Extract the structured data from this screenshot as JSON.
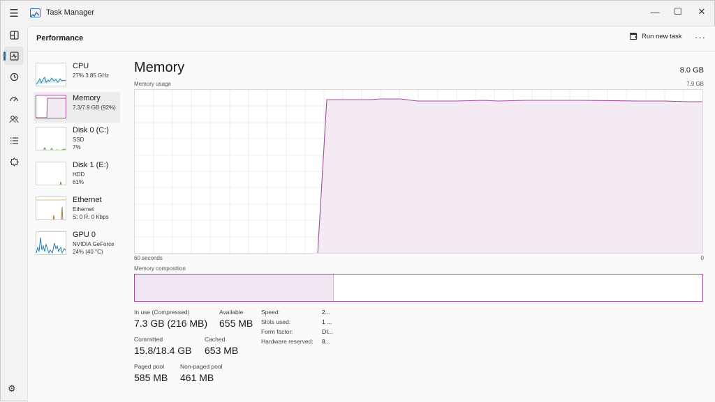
{
  "app": {
    "title": "Task Manager"
  },
  "window_controls": {
    "minimize": "—",
    "maximize": "☐",
    "close": "✕"
  },
  "header": {
    "title": "Performance",
    "run_new_task": "Run new task",
    "more": "···"
  },
  "rail": {
    "items": [
      {
        "name": "processes-icon"
      },
      {
        "name": "performance-icon",
        "active": true
      },
      {
        "name": "app-history-icon"
      },
      {
        "name": "startup-apps-icon"
      },
      {
        "name": "users-icon"
      },
      {
        "name": "details-icon"
      },
      {
        "name": "services-icon"
      }
    ]
  },
  "resources": [
    {
      "name": "CPU",
      "line1": "27%  3.85 GHz",
      "line2": ""
    },
    {
      "name": "Memory",
      "line1": "7.3/7.9 GB (92%)",
      "line2": ""
    },
    {
      "name": "Disk 0 (C:)",
      "line1": "SSD",
      "line2": "7%"
    },
    {
      "name": "Disk 1 (E:)",
      "line1": "HDD",
      "line2": "61%"
    },
    {
      "name": "Ethernet",
      "line1": "Ethernet",
      "line2": "S: 0  R: 0 Kbps"
    },
    {
      "name": "GPU 0",
      "line1": "NVIDIA GeForce",
      "line2": "24%  (40 °C)"
    }
  ],
  "memory": {
    "title": "Memory",
    "total": "8.0 GB",
    "usage_label": "Memory usage",
    "usage_max": "7.9 GB",
    "time_left": "60 seconds",
    "time_right": "0",
    "composition_label": "Memory composition",
    "composition_in_use_fraction": 0.35,
    "stats": {
      "in_use_label": "In use (Compressed)",
      "in_use_value": "7.3 GB (216 MB)",
      "available_label": "Available",
      "available_value": "655 MB",
      "committed_label": "Committed",
      "committed_value": "15.8/18.4 GB",
      "cached_label": "Cached",
      "cached_value": "653 MB",
      "paged_label": "Paged pool",
      "paged_value": "585 MB",
      "nonpaged_label": "Non-paged pool",
      "nonpaged_value": "461 MB"
    },
    "details": [
      {
        "label": "Speed:",
        "value": "2..."
      },
      {
        "label": "Slots used:",
        "value": "1 ..."
      },
      {
        "label": "Form factor:",
        "value": "DI..."
      },
      {
        "label": "Hardware reserved:",
        "value": "8..."
      }
    ]
  },
  "colors": {
    "accent": "#9c4f97",
    "fill": "#f3eaf3",
    "grid": "#ececec",
    "cpu": "#1c7fb0"
  }
}
